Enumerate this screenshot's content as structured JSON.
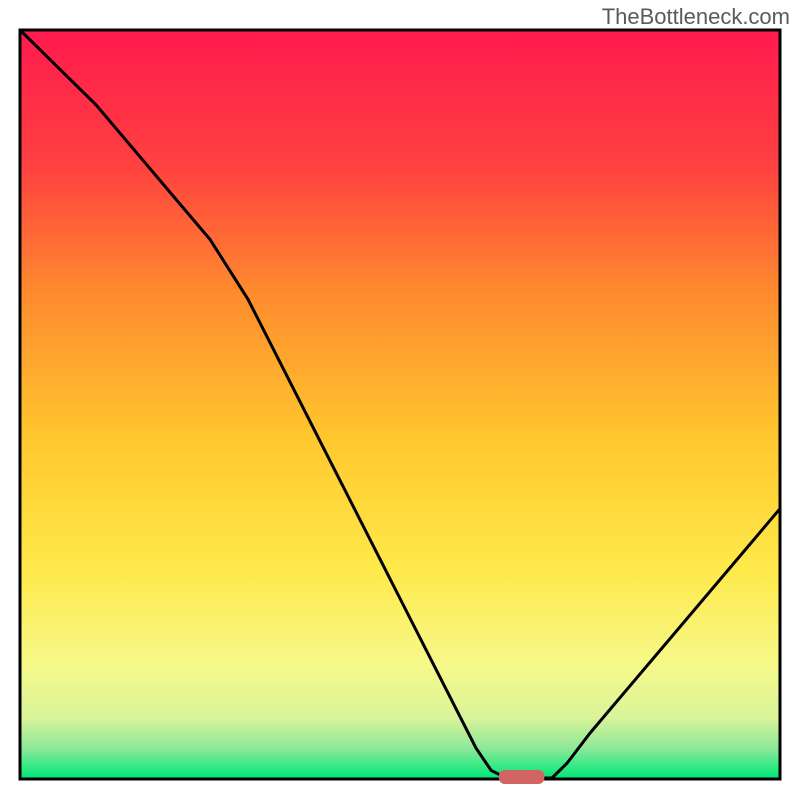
{
  "watermark": "TheBottleneck.com",
  "chart_data": {
    "type": "line",
    "title": "",
    "xlabel": "",
    "ylabel": "",
    "x": [
      0,
      5,
      10,
      15,
      20,
      25,
      30,
      35,
      40,
      45,
      50,
      55,
      60,
      62,
      64,
      68,
      70,
      72,
      75,
      80,
      85,
      90,
      95,
      100
    ],
    "values": [
      100,
      95,
      90,
      84,
      78,
      72,
      64,
      54,
      44,
      34,
      24,
      14,
      4,
      1,
      0,
      0,
      0,
      2,
      6,
      12,
      18,
      24,
      30,
      36
    ],
    "xlim": [
      0,
      100
    ],
    "ylim": [
      0,
      100
    ],
    "annotations": {
      "minimum_marker": {
        "x_start": 63,
        "x_end": 69,
        "y": 0
      }
    }
  },
  "colors": {
    "gradient_top": "#ff1a4e",
    "gradient_mid_upper": "#ff6a33",
    "gradient_mid": "#ffd52e",
    "gradient_mid_lower": "#f8f76e",
    "gradient_low": "#b8f08a",
    "gradient_bottom": "#00e878",
    "border": "#000000",
    "curve": "#000000",
    "marker": "#d36464"
  }
}
